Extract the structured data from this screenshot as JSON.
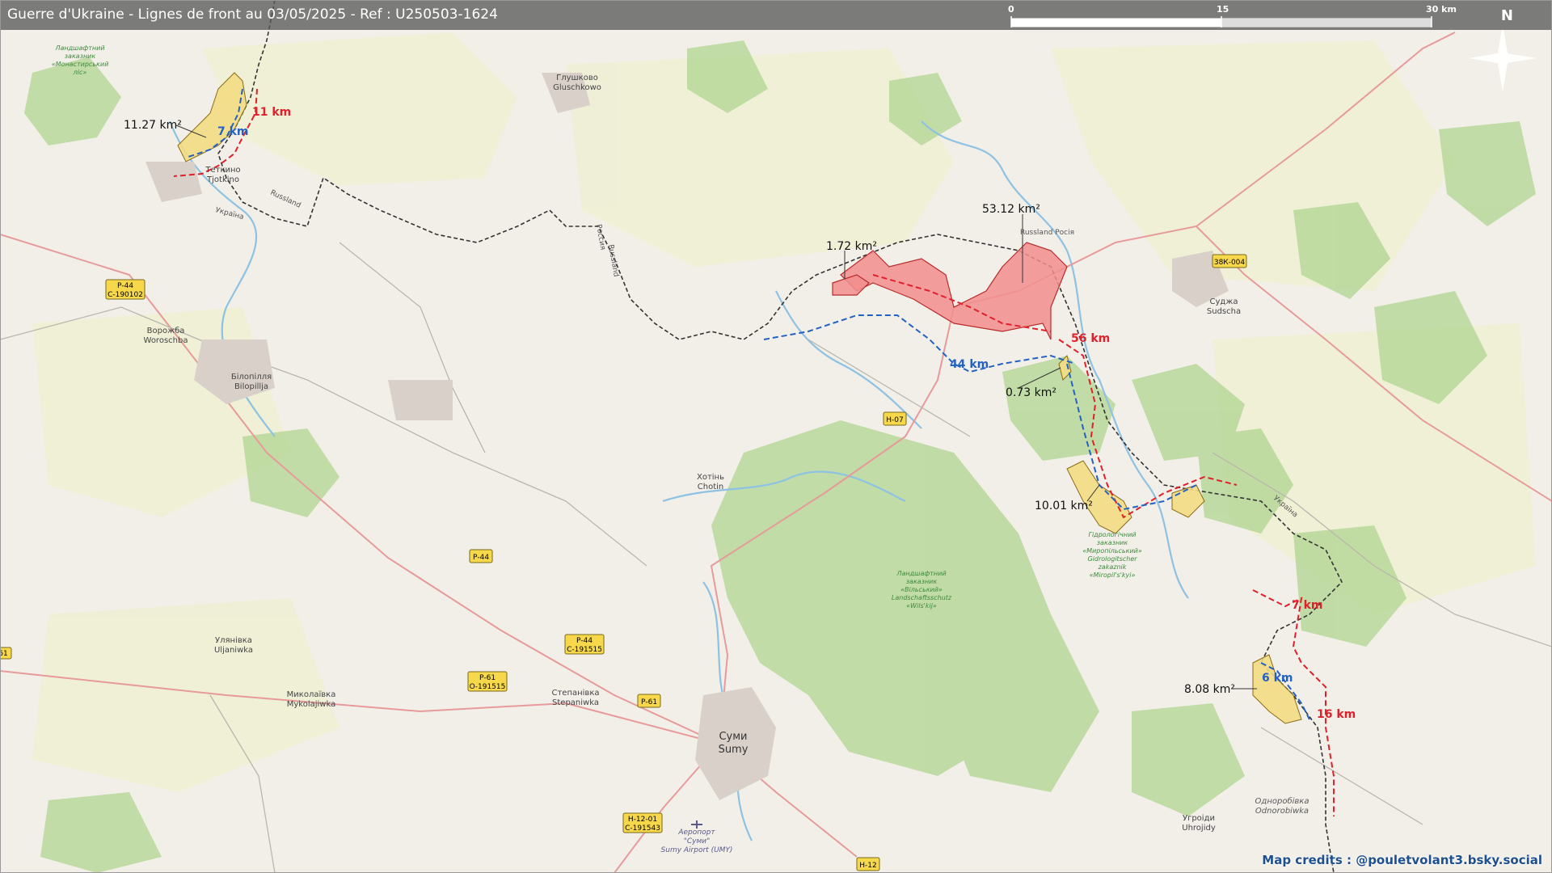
{
  "title": "Guerre d'Ukraine - Lignes de front au 03/05/2025 - Ref : U250503-1624",
  "scale_bar": {
    "labels": [
      "0",
      "15",
      "30 km"
    ]
  },
  "compass": {
    "north_label": "N"
  },
  "credit": "Map credits : @pouletvolant3.bsky.social",
  "colors": {
    "russian_gain": "#f28e8e",
    "ukrainian_gain": "#f3dc84",
    "front_red": "#e0202a",
    "front_blue": "#2462c2",
    "border": "#333333",
    "forest": "#a9cf8a",
    "water": "#8ec2e3",
    "road_primary": "#e79a9a"
  },
  "area_labels": [
    {
      "id": "area-1",
      "text": "11.27 km²"
    },
    {
      "id": "area-2",
      "text": "1.72 km²"
    },
    {
      "id": "area-3",
      "text": "53.12 km²"
    },
    {
      "id": "area-4",
      "text": "0.73 km²"
    },
    {
      "id": "area-5",
      "text": "10.01 km²"
    },
    {
      "id": "area-6",
      "text": "8.08 km²"
    }
  ],
  "distance_labels": [
    {
      "id": "dist-1",
      "text": "11 km",
      "color": "red"
    },
    {
      "id": "dist-2",
      "text": "7 km",
      "color": "blue"
    },
    {
      "id": "dist-3",
      "text": "56 km",
      "color": "red"
    },
    {
      "id": "dist-4",
      "text": "44 km",
      "color": "blue"
    },
    {
      "id": "dist-5",
      "text": "7 km",
      "color": "red"
    },
    {
      "id": "dist-6",
      "text": "6 km",
      "color": "blue"
    },
    {
      "id": "dist-7",
      "text": "16 km",
      "color": "red"
    }
  ],
  "places": [
    {
      "id": "hlushkovo",
      "lines": [
        "Глушково",
        "Gluschkowo"
      ]
    },
    {
      "id": "tetkino",
      "lines": [
        "Теткино",
        "Tjotkino"
      ]
    },
    {
      "id": "sudzha",
      "lines": [
        "Суджа",
        "Sudscha"
      ]
    },
    {
      "id": "vorozhba",
      "lines": [
        "Ворожба",
        "Woroschba"
      ]
    },
    {
      "id": "bilopillia",
      "lines": [
        "Білопілля",
        "Bilopillja"
      ]
    },
    {
      "id": "khotin",
      "lines": [
        "Хотінь",
        "Chotin"
      ]
    },
    {
      "id": "ulianivka",
      "lines": [
        "Улянівка",
        "Uljaniwka"
      ]
    },
    {
      "id": "mykolaivka",
      "lines": [
        "Миколаївка",
        "Mykolajiwka"
      ]
    },
    {
      "id": "stepanivka",
      "lines": [
        "Степанівка",
        "Stepaniwka"
      ]
    },
    {
      "id": "sumy",
      "lines": [
        "Суми",
        "Sumy"
      ]
    },
    {
      "id": "uhroidy",
      "lines": [
        "Угроіди",
        "Uhrojidy"
      ]
    },
    {
      "id": "odnorobivka",
      "lines": [
        "Одноробівка",
        "Odnorobiwka"
      ]
    },
    {
      "id": "airport",
      "lines": [
        "Аеропорт",
        "\"Суми\"",
        "Sumy Airport (UMY)"
      ]
    }
  ],
  "reserve_labels": [
    {
      "id": "reserve-nw",
      "lines": [
        "Ландшафтний",
        "заказник",
        "«Монастирський",
        "ліс»"
      ]
    },
    {
      "id": "reserve-myropil",
      "lines": [
        "Гідрологічний",
        "заказник",
        "«Миропільський»",
        "Gidrologitscher",
        "zakaznik",
        "«Miropil's'kyi»"
      ]
    },
    {
      "id": "reserve-vilsk",
      "lines": [
        "Ландшафтний",
        "заказник",
        "«Вільський»",
        "Landschaftsschutz",
        "«Wils'kij»"
      ]
    }
  ],
  "border_labels": [
    {
      "id": "border-1",
      "text": "Russland"
    },
    {
      "id": "border-2",
      "text": "Україна"
    },
    {
      "id": "border-3",
      "text": "Russland"
    },
    {
      "id": "border-4",
      "text": "Россия"
    },
    {
      "id": "border-5",
      "text": "Russland Росія"
    },
    {
      "id": "border-6",
      "text": "Україна"
    }
  ],
  "road_shields": [
    {
      "id": "r1",
      "text": "Р-44",
      "sub": "С-190102"
    },
    {
      "id": "r2",
      "text": "Н-07",
      "sub": ""
    },
    {
      "id": "r3",
      "text": "Р-44",
      "sub": ""
    },
    {
      "id": "r4",
      "text": "Р-44",
      "sub": "С-191515"
    },
    {
      "id": "r5",
      "text": "Р-61",
      "sub": "О-191515"
    },
    {
      "id": "r6",
      "text": "Р-61",
      "sub": ""
    },
    {
      "id": "r7",
      "text": "Н-12-01",
      "sub": "С-191543"
    },
    {
      "id": "r8",
      "text": "Н-12",
      "sub": ""
    },
    {
      "id": "r9",
      "text": "38К-004",
      "sub": ""
    },
    {
      "id": "r10",
      "text": "61",
      "sub": ""
    }
  ]
}
